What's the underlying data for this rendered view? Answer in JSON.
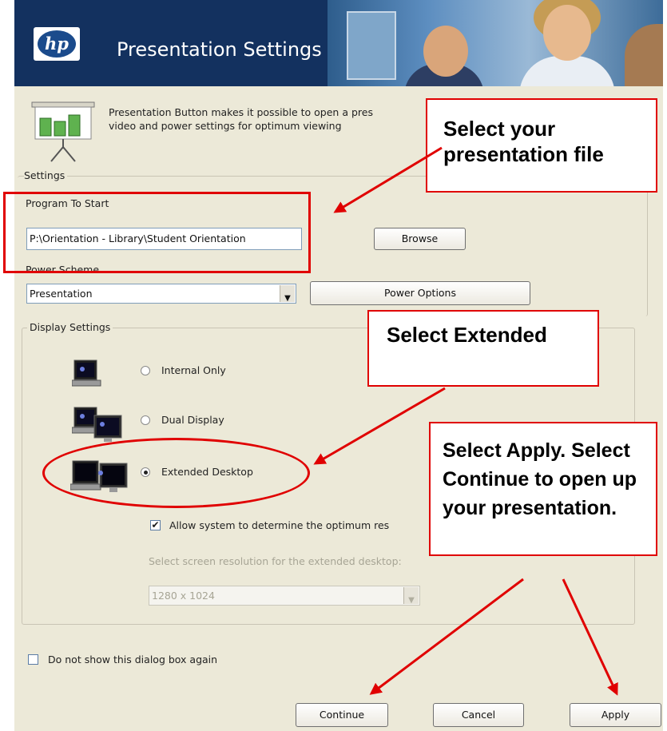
{
  "dialog": {
    "title": "Presentation Settings",
    "brand": "hp",
    "intro_line1": "Presentation Button makes it possible to open a pres",
    "intro_line2": "video and power settings for optimum viewing"
  },
  "settings": {
    "group_title": "Settings",
    "program_label": "Program To Start",
    "program_value": "P:\\Orientation - Library\\Student Orientation",
    "browse_label": "Browse",
    "power_scheme_label": "Power Scheme",
    "power_scheme_value": "Presentation",
    "power_options_label": "Power Options"
  },
  "display": {
    "group_title": "Display Settings",
    "options": [
      {
        "label": "Internal Only",
        "selected": false
      },
      {
        "label": "Dual Display",
        "selected": false
      },
      {
        "label": "Extended Desktop",
        "selected": true
      }
    ],
    "allow_checkbox_label": "Allow system to determine the optimum res",
    "allow_checked": true,
    "resolution_label": "Select screen resolution for the extended desktop:",
    "resolution_value": "1280 x 1024"
  },
  "footer": {
    "dont_show_label": "Do not show this dialog box again",
    "dont_show_checked": false,
    "continue_label": "Continue",
    "cancel_label": "Cancel",
    "apply_label": "Apply"
  },
  "callouts": {
    "file": "Select your presentation file",
    "extended": "Select Extended",
    "apply": "Select Apply. Select Continue to open up your presentation."
  },
  "colors": {
    "banner": "#13315f",
    "dialog_bg": "#ece9d8",
    "annotation_red": "#e00000"
  }
}
